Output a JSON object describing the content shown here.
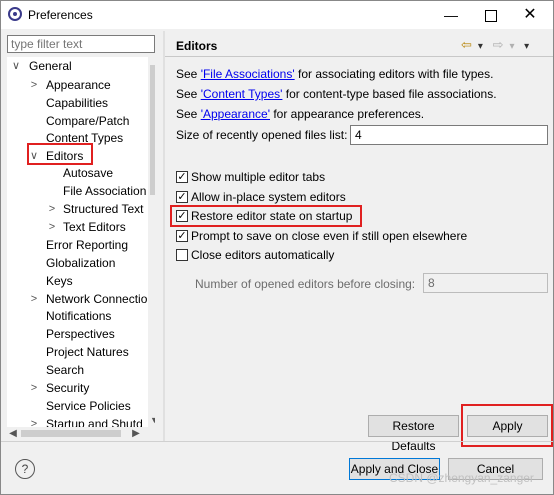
{
  "window": {
    "title": "Preferences",
    "minimize_glyph": "—",
    "close_glyph": "✕"
  },
  "filter": {
    "placeholder": "type filter text"
  },
  "tree": {
    "items": [
      {
        "label": "General",
        "twisty": "∨"
      },
      {
        "label": "Appearance",
        "twisty": ">"
      },
      {
        "label": "Capabilities",
        "twisty": ""
      },
      {
        "label": "Compare/Patch",
        "twisty": ""
      },
      {
        "label": "Content Types",
        "twisty": ""
      },
      {
        "label": "Editors",
        "twisty": "∨"
      },
      {
        "label": "Autosave",
        "twisty": ""
      },
      {
        "label": "File Association",
        "twisty": ""
      },
      {
        "label": "Structured Text",
        "twisty": ">"
      },
      {
        "label": "Text Editors",
        "twisty": ">"
      },
      {
        "label": "Error Reporting",
        "twisty": ""
      },
      {
        "label": "Globalization",
        "twisty": ""
      },
      {
        "label": "Keys",
        "twisty": ""
      },
      {
        "label": "Network Connectio",
        "twisty": ">"
      },
      {
        "label": "Notifications",
        "twisty": ""
      },
      {
        "label": "Perspectives",
        "twisty": ""
      },
      {
        "label": "Project Natures",
        "twisty": ""
      },
      {
        "label": "Search",
        "twisty": ""
      },
      {
        "label": "Security",
        "twisty": ">"
      },
      {
        "label": "Service Policies",
        "twisty": ""
      },
      {
        "label": "Startup and Shutd",
        "twisty": ">"
      }
    ]
  },
  "page": {
    "title": "Editors",
    "nav": {
      "back": "⇦",
      "back_menu": "▾",
      "forward": "⇨",
      "forward_menu": "▾",
      "menu": "▾"
    },
    "see1": {
      "prefix": "See ",
      "link": "'File Associations'",
      "suffix": " for associating editors with file types."
    },
    "see2": {
      "prefix": "See ",
      "link": "'Content Types'",
      "suffix": " for content-type based file associations."
    },
    "see3": {
      "prefix": "See ",
      "link": "'Appearance'",
      "suffix": " for appearance preferences."
    },
    "recent_files": {
      "label": "Size of recently opened files list:",
      "value": "4"
    },
    "options": [
      {
        "label": "Show multiple editor tabs",
        "checked": true
      },
      {
        "label": "Allow in-place system editors",
        "checked": true
      },
      {
        "label": "Restore editor state on startup",
        "checked": true
      },
      {
        "label": "Prompt to save on close even if still open elsewhere",
        "checked": true
      },
      {
        "label": "Close editors automatically",
        "checked": false
      }
    ],
    "opened_editors": {
      "label": "Number of opened editors before closing:",
      "value": "8"
    },
    "restore_defaults": "Restore Defaults",
    "apply": "Apply"
  },
  "footer": {
    "help": "?",
    "apply_close": "Apply and Close",
    "cancel": "Cancel",
    "watermark": "CSDN @zhengyan_zanger"
  },
  "check_glyph": "✓",
  "highlight_color": "#e02020"
}
